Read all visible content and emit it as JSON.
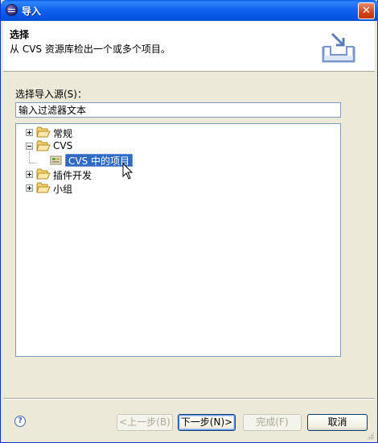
{
  "window": {
    "title": "导入",
    "close_glyph": "✕"
  },
  "header": {
    "title": "选择",
    "description": "从 CVS 资源库检出一个或多个项目。",
    "icon": "import-wizard-icon"
  },
  "source": {
    "label": "选择导入源(S)：",
    "filter_value": "输入过滤器文本"
  },
  "tree": {
    "items": [
      {
        "label": "常规",
        "state": "collapsed",
        "icon": "folder-icon"
      },
      {
        "label": "CVS",
        "state": "expanded",
        "icon": "folder-icon"
      },
      {
        "label": "CVS 中的项目",
        "state": "selected",
        "icon": "cvs-project-icon"
      },
      {
        "label": "插件开发",
        "state": "collapsed",
        "icon": "folder-icon"
      },
      {
        "label": "小组",
        "state": "collapsed",
        "icon": "folder-icon"
      }
    ]
  },
  "footer": {
    "help_glyph": "?",
    "back_label": "<上一步(B)",
    "next_label": "下一步(N)>",
    "finish_label": "完成(F)",
    "cancel_label": "取消"
  },
  "colors": {
    "titlebar": "#0454E6",
    "selection": "#316AC5",
    "dialog_bg": "#ECE9D8",
    "folder": "#F4D26E"
  }
}
